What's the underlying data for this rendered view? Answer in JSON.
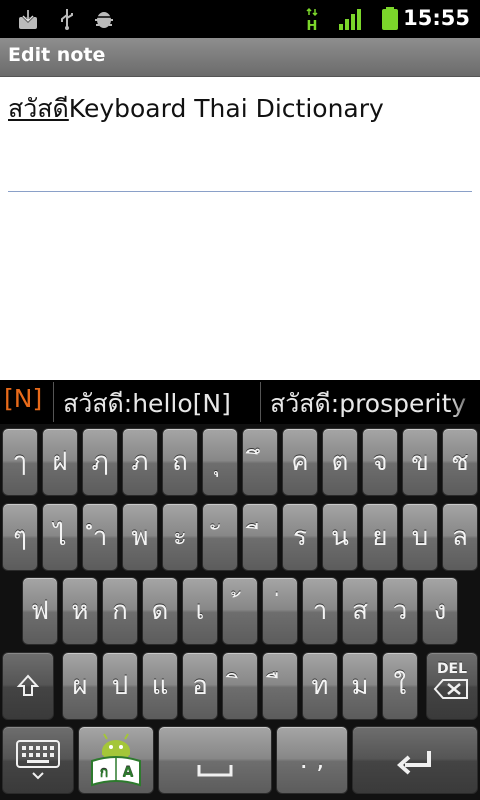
{
  "status_bar": {
    "time": "15:55",
    "network_type": "H",
    "icons": [
      "download-icon",
      "usb-icon",
      "android-debug-icon",
      "network-h-icon",
      "signal-icon",
      "battery-icon"
    ]
  },
  "title_bar": {
    "title": "Edit note"
  },
  "note": {
    "composing": "สวัสดี",
    "text": "Keyboard Thai Dictionary"
  },
  "suggestions": [
    "[N]",
    "สวัสดี:hello[N]",
    "สวัสดี:prosperity"
  ],
  "keyboard": {
    "row1": [
      "ๅ",
      "ฝ",
      "ฦ",
      "ภ",
      "ถ",
      "ุ",
      "ึ",
      "ค",
      "ต",
      "จ",
      "ข",
      "ช"
    ],
    "row2": [
      "ๆ",
      "ไ",
      "ำ",
      "พ",
      "ะ",
      "ั",
      "ี",
      "ร",
      "น",
      "ย",
      "บ",
      "ล"
    ],
    "row3": [
      "ฟ",
      "ห",
      "ก",
      "ด",
      "เ",
      "้",
      "่",
      "า",
      "ส",
      "ว",
      "ง"
    ],
    "row4": [
      "ผ",
      "ป",
      "แ",
      "อ",
      "ิ",
      "ื",
      "ท",
      "ม",
      "ใ"
    ],
    "del_label": "DEL",
    "punct_label": ". ,"
  },
  "colors": {
    "suggestion_highlight": "#e86a1a",
    "status_green": "#7bd62b"
  }
}
